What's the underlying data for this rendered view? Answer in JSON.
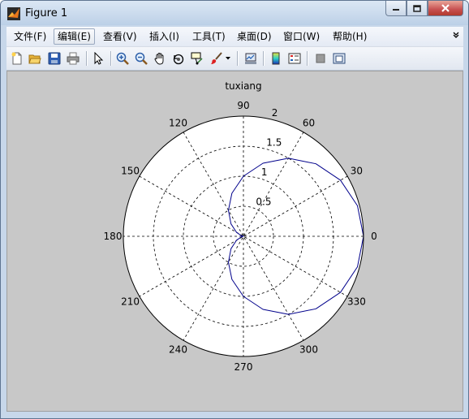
{
  "window": {
    "title": "Figure 1",
    "controls": [
      "minimize",
      "maximize",
      "close"
    ]
  },
  "menubar": {
    "items": [
      {
        "label": "文件(F)"
      },
      {
        "label": "编辑(E)"
      },
      {
        "label": "查看(V)"
      },
      {
        "label": "插入(I)"
      },
      {
        "label": "工具(T)"
      },
      {
        "label": "桌面(D)"
      },
      {
        "label": "窗口(W)"
      },
      {
        "label": "帮助(H)"
      }
    ],
    "active_index": 1,
    "overflow_icon": "chevron-icon"
  },
  "toolbar": {
    "buttons": [
      "new-figure-icon",
      "open-file-icon",
      "save-icon",
      "print-icon",
      "edit-plot-arrow-icon",
      "zoom-in-icon",
      "zoom-out-icon",
      "pan-hand-icon",
      "rotate-3d-icon",
      "data-cursor-icon",
      "brush-icon",
      "brush-dropdown-icon",
      "link-plot-icon",
      "insert-colorbar-icon",
      "insert-legend-icon",
      "hide-plot-tools-icon",
      "show-plot-tools-icon"
    ]
  },
  "colors": {
    "figure_bg": "#c8c8c8",
    "axes_bg": "#ffffff",
    "curve": "#00008b",
    "grid": "#000000"
  },
  "chart_data": {
    "type": "line",
    "coordinate_system": "polar",
    "title": "tuxiang",
    "angle_tick_labels": [
      "0",
      "30",
      "60",
      "90",
      "120",
      "150",
      "180",
      "210",
      "240",
      "270",
      "300",
      "330"
    ],
    "radial_tick_labels": [
      "0.5",
      "1",
      "1.5",
      "2"
    ],
    "rlim": [
      0,
      2
    ],
    "grid": true,
    "series": [
      {
        "curve": "cardioid r = 1 + cos(theta)",
        "theta_degrees": [
          0,
          15,
          30,
          45,
          60,
          75,
          90,
          105,
          120,
          135,
          150,
          165,
          180,
          195,
          210,
          225,
          240,
          255,
          270,
          285,
          300,
          315,
          330,
          345,
          360
        ],
        "r": [
          2.0,
          1.966,
          1.866,
          1.707,
          1.5,
          1.259,
          1.0,
          0.741,
          0.5,
          0.293,
          0.134,
          0.034,
          0.0,
          0.034,
          0.134,
          0.293,
          0.5,
          0.741,
          1.0,
          1.259,
          1.5,
          1.707,
          1.866,
          1.966,
          2.0
        ]
      }
    ]
  }
}
